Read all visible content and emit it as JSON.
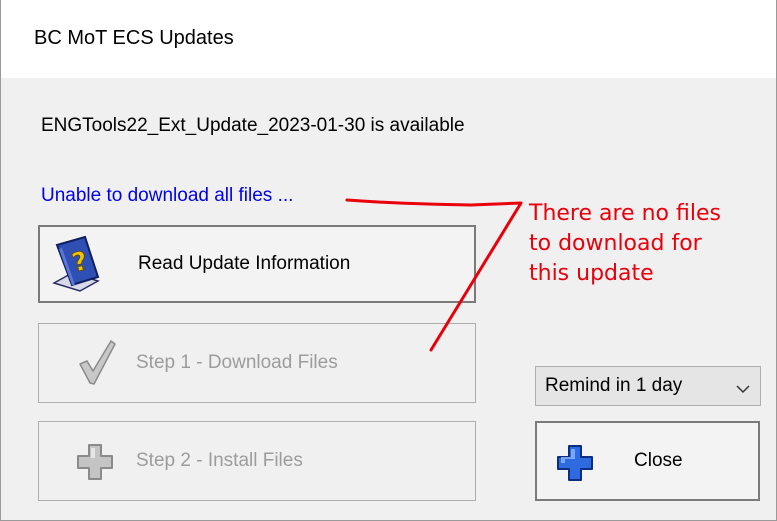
{
  "window": {
    "title": "BC MoT ECS Updates"
  },
  "status_message": "ENGTools22_Ext_Update_2023-01-30 is available",
  "error_link": "Unable to download all files ...",
  "buttons": {
    "read_info": "Read Update Information",
    "download": "Step 1 - Download Files",
    "install": "Step 2 - Install Files",
    "close": "Close"
  },
  "remind_select": {
    "selected": "Remind in 1 day"
  },
  "annotation": {
    "lines": [
      "There are no files",
      "to download for",
      "this update"
    ],
    "color": "#e8000b"
  },
  "icons": {
    "read_info": "help-book-icon",
    "download": "checkmark-icon",
    "install": "plus-icon",
    "close": "plus-icon",
    "select": "chevron-down-icon"
  },
  "colors": {
    "link": "#0000ee",
    "disabled_text": "#9c9c9c",
    "close_icon": "#1e5bd8"
  }
}
